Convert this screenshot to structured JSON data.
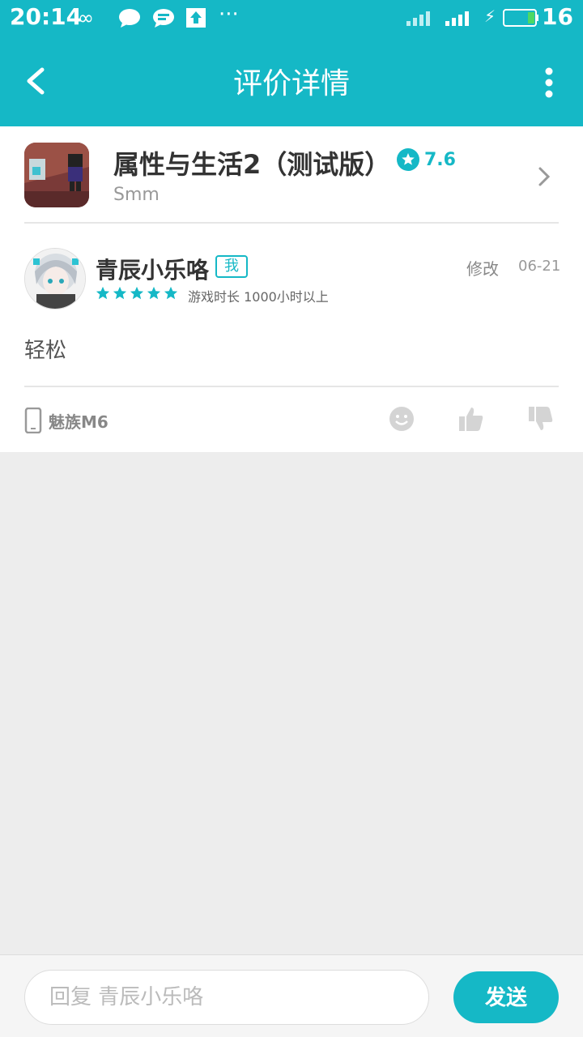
{
  "status_bar": {
    "time": "20:14",
    "battery": "16"
  },
  "app_bar": {
    "title": "评价详情"
  },
  "game": {
    "name": "属性与生活2（测试版）",
    "score": "7.6",
    "developer": "Smm"
  },
  "review": {
    "username": "青辰小乐咯",
    "me_badge": "我",
    "rating_stars": 5,
    "playtime": "游戏时长 1000小时以上",
    "edit_label": "修改",
    "date": "06-21",
    "content": "轻松",
    "device": "魅族M6"
  },
  "reply": {
    "placeholder": "回复 青辰小乐咯",
    "send_label": "发送"
  },
  "colors": {
    "accent": "#15b8c6",
    "background": "#ededed"
  }
}
